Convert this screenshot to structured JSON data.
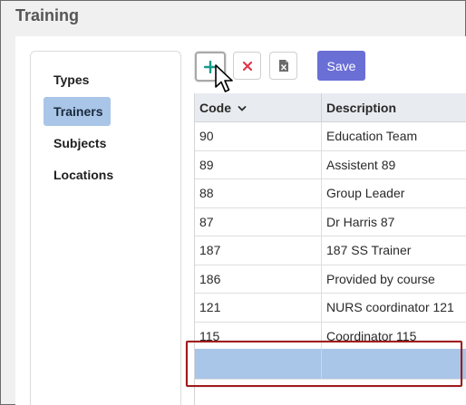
{
  "page": {
    "title": "Training"
  },
  "sidebar": {
    "items": [
      {
        "label": "Types",
        "active": false
      },
      {
        "label": "Trainers",
        "active": true
      },
      {
        "label": "Subjects",
        "active": false
      },
      {
        "label": "Locations",
        "active": false
      }
    ]
  },
  "toolbar": {
    "add_icon": "plus-icon",
    "delete_icon": "close-icon",
    "export_icon": "excel-file-icon",
    "save_label": "Save",
    "colors": {
      "save": "#6a6fd6",
      "add": "#1a9a8a",
      "delete": "#e0364a"
    }
  },
  "grid": {
    "columns": [
      {
        "label": "Code",
        "sort_icon": "chevron-down-icon"
      },
      {
        "label": "Description"
      }
    ],
    "rows": [
      {
        "code": "90",
        "description": "Education Team"
      },
      {
        "code": "89",
        "description": "Assistent 89"
      },
      {
        "code": "88",
        "description": "Group Leader"
      },
      {
        "code": "87",
        "description": "Dr Harris 87"
      },
      {
        "code": "187",
        "description": "187 SS Trainer"
      },
      {
        "code": "186",
        "description": "Provided by course"
      },
      {
        "code": "121",
        "description": "NURS coordinator 121"
      },
      {
        "code": "115",
        "description": "Coordinator 115"
      }
    ],
    "new_row": {
      "code": "",
      "description": ""
    },
    "selected_row_color": "#a9c5e8",
    "highlight_color": "#a11a1a"
  }
}
